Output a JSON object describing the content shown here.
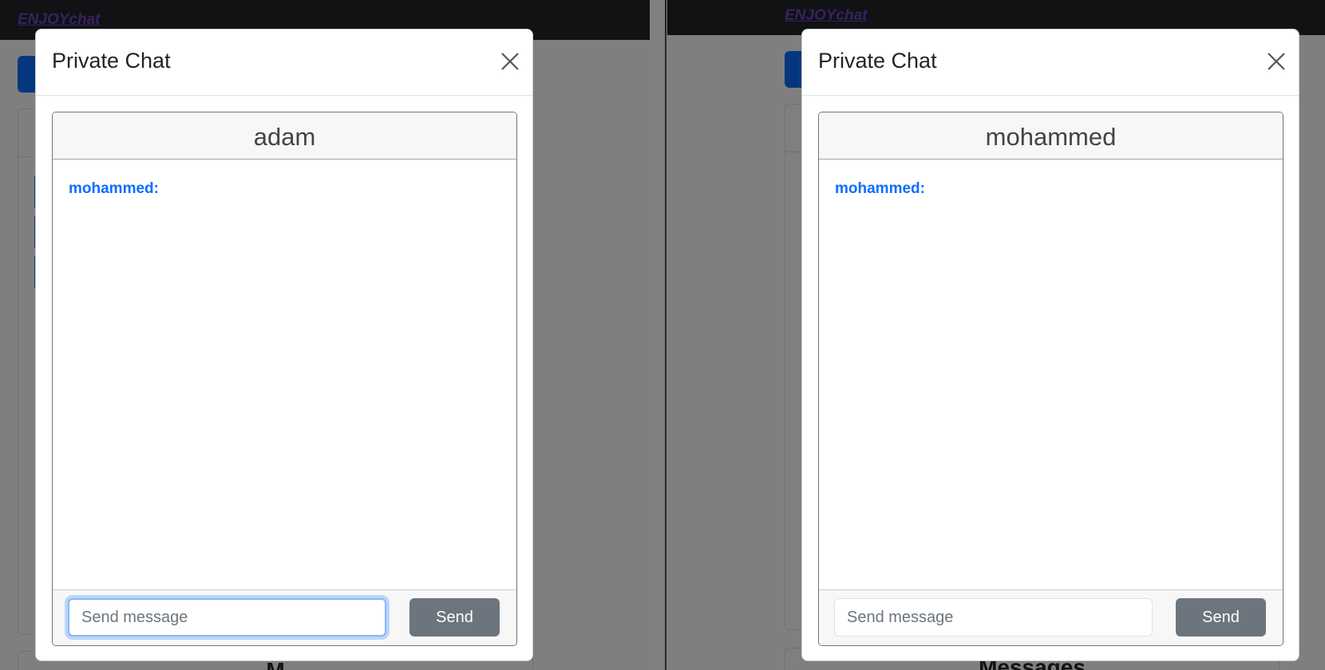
{
  "left_window": {
    "brand": "ENJOYchat",
    "modal": {
      "title": "Private Chat",
      "chat_partner": "adam",
      "messages": [
        {
          "sender": "mohammed:",
          "text": ""
        }
      ],
      "input_placeholder": "Send message",
      "input_value": "",
      "input_focused": true,
      "send_label": "Send"
    },
    "background_heading": "M"
  },
  "right_window": {
    "brand": "ENJOYchat",
    "modal": {
      "title": "Private Chat",
      "chat_partner": "mohammed",
      "messages": [
        {
          "sender": "mohammed:",
          "text": ""
        }
      ],
      "input_placeholder": "Send message",
      "input_value": "",
      "input_focused": false,
      "send_label": "Send"
    },
    "background_heading": "Messages"
  },
  "colors": {
    "accent": "#0d6efd",
    "brand": "#6f42c1",
    "navbar": "#212529",
    "send_button": "#6c757d"
  },
  "icons": {
    "close": "close-icon"
  }
}
